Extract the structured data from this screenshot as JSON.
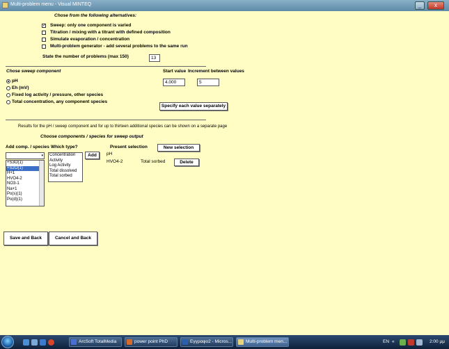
{
  "window": {
    "title": "Multi-problem menu - Visual MINTEQ",
    "min": "_",
    "close": "x"
  },
  "alternatives": {
    "heading": "Chose from the following alternatives:",
    "options": [
      {
        "label": "Sweep: only one component is varied",
        "checked": true
      },
      {
        "label": "Titration / mixing with a titrant with defined composition",
        "checked": false
      },
      {
        "label": "Simulate evaporation / concentration",
        "checked": false
      },
      {
        "label": "Multi-problem generator - add several problems to the same run",
        "checked": false
      }
    ],
    "num_label": "State the number of problems (max 150)",
    "num_value": "13"
  },
  "sweep": {
    "heading": "Chose sweep component",
    "options": [
      {
        "label": "pH",
        "selected": true
      },
      {
        "label": "Eh (mV)",
        "selected": false
      },
      {
        "label": "Fixed log activity / pressure, other species",
        "selected": false
      },
      {
        "label": "Total concentration, any component species",
        "selected": false
      }
    ],
    "start_label": "Start value",
    "increment_label": "Increment between values",
    "start_value": "4.000",
    "increment_value": "5",
    "specify_button": "Specify each value separately"
  },
  "results_note": "Results for the pH / sweep component and for up to thirteen additional species can be shown on a separate page",
  "output": {
    "heading": "Choose components / species for sweep output",
    "add_label": "Add comp. / species",
    "type_label": "Which type?",
    "present_label": "Present selection",
    "new_selection_button": "New selection",
    "add_button": "Add",
    "delete_button": "Delete",
    "species_list": [
      "+S3O(1)",
      "+S2O(1)",
      "H+1",
      "HVO4-2",
      "NO3-1",
      "Na+1",
      "Po(s)(1)",
      "Po(d)(1)"
    ],
    "species_selected_index": 1,
    "type_list": [
      "Concentration",
      "Activity",
      "Log Activity",
      "Total dissolved",
      "Total sorbed"
    ],
    "present": [
      {
        "species": "pH",
        "type": ""
      },
      {
        "species": "HVO4-2",
        "type": "Total sorbed"
      }
    ]
  },
  "buttons": {
    "save": "Save and Back",
    "cancel": "Cancel and Back"
  },
  "taskbar": {
    "tasks": [
      "ArcSoft TotalMedia",
      "power point PhD",
      "Εγγραφο2 - Micros...",
      "Multi-problem men..."
    ],
    "lang": "EN",
    "time": "2:00 μμ"
  },
  "colors": {
    "background": "#fffdc4",
    "selection": "#3b6fc8"
  }
}
